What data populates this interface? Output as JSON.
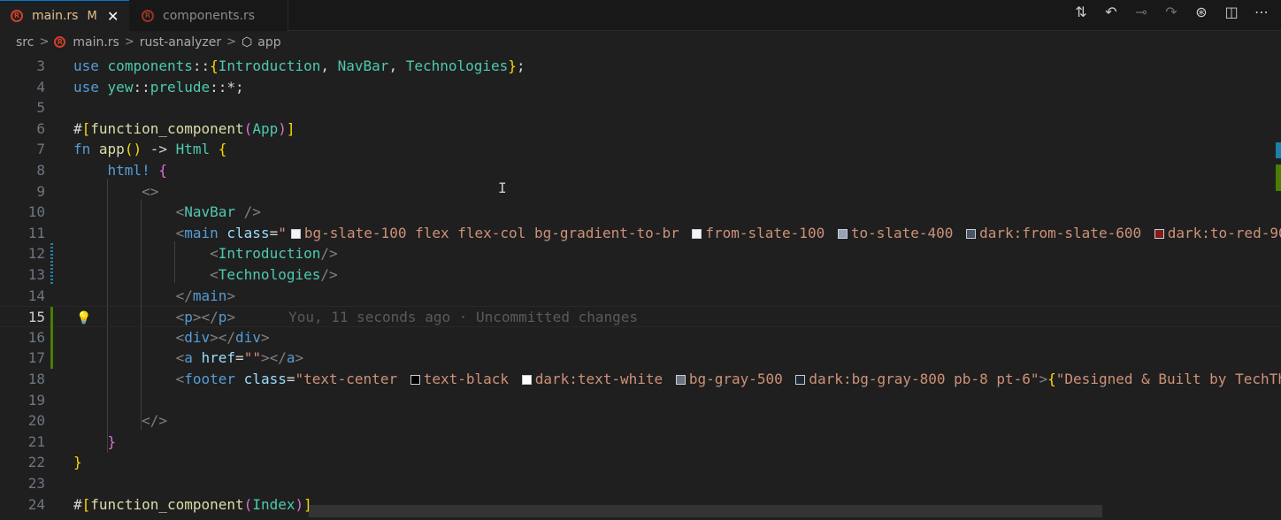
{
  "tabs": [
    {
      "label": "main.rs",
      "modified": "M",
      "close": "✕"
    },
    {
      "label": "components.rs"
    }
  ],
  "editor_actions": [
    "source-control-icon",
    "go-back-icon",
    "git-commit-icon",
    "go-forward-icon",
    "timeline-icon",
    "split-editor-icon",
    "more-icon"
  ],
  "breadcrumb": {
    "folder": "src",
    "file": "main.rs",
    "crate": "rust-analyzer",
    "symbol": "app"
  },
  "blame": "You, 11 seconds ago · Uncommitted changes",
  "lines": [
    3,
    4,
    5,
    6,
    7,
    8,
    9,
    10,
    11,
    12,
    13,
    14,
    15,
    16,
    17,
    18,
    19,
    20,
    21,
    22,
    23,
    24
  ],
  "swatch_colors": {
    "slate100": "#f1f5f9",
    "slate400": "#94a3b8",
    "slate600": "#475569",
    "red900": "#7f1d1d",
    "black": "#000000",
    "white": "#ffffff",
    "gray500": "#6b7280",
    "gray800": "#1f2937"
  }
}
